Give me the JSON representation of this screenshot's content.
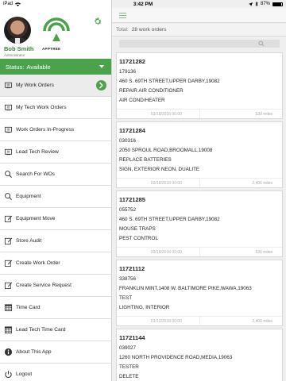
{
  "status_bar": {
    "device": "iPad",
    "time": "3:42 PM",
    "battery_pct": "87%",
    "battery_level": 0.87
  },
  "profile": {
    "name": "Bob Smith",
    "role": "Administrator",
    "logo_text": "APPTREE"
  },
  "status": {
    "label": "Status:",
    "value": "Available"
  },
  "menu": [
    {
      "label": "My Work Orders",
      "icon": "clipboard-icon",
      "active": true
    },
    {
      "label": "My Tech Work Orders",
      "icon": "clipboard-icon"
    },
    {
      "label": "Work Orders In-Progress",
      "icon": "clipboard-icon"
    },
    {
      "label": "Lead Tech Review",
      "icon": "clipboard-icon"
    },
    {
      "label": "Search For WOs",
      "icon": "search-icon"
    },
    {
      "label": "Equipment",
      "icon": "search-icon"
    },
    {
      "label": "Equipment Move",
      "icon": "edit-icon"
    },
    {
      "label": "Store Audit",
      "icon": "edit-icon"
    },
    {
      "label": "Create Work Order",
      "icon": "edit-icon"
    },
    {
      "label": "Create Service Request",
      "icon": "edit-icon"
    },
    {
      "label": "Time Card",
      "icon": "calendar-icon"
    },
    {
      "label": "Lead Tech Time Card",
      "icon": "calendar-icon"
    },
    {
      "label": "About This App",
      "icon": "info-icon"
    },
    {
      "label": "Logout",
      "icon": "power-icon"
    }
  ],
  "main": {
    "total_label": "Total:",
    "total_value": "28 work orders"
  },
  "work_orders": [
    {
      "wo": "11721282",
      "store": "179136",
      "address": "460 S. 69TH STREET,UPPER DARBY,19082",
      "desc": "REPAIR AIR CONDITIONER",
      "category": "AIR COND/HEATER",
      "date": "03/18/2016 00:00",
      "miles": "530 miles"
    },
    {
      "wo": "11721284",
      "store": "030316",
      "address": "2050 SPROUL ROAD,BROOMALL,19008",
      "desc": "REPLACE BATTERIES",
      "category": "SIGN, EXTERIOR NEON, DUALITE",
      "date": "03/18/2016 00:00",
      "miles": "2,400 miles"
    },
    {
      "wo": "11721285",
      "store": "055752",
      "address": "460 S. 69TH STREET,UPPER DARBY,19082",
      "desc": "MOUSE TRAPS",
      "category": "PEST CONTROL",
      "date": "03/18/2016 00:00",
      "miles": "530 miles"
    },
    {
      "wo": "11721112",
      "store": "338756",
      "address": "FRANKLIN MINT,1408 W. BALTIMORE PIKE,WAWA,19063",
      "desc": "TEST",
      "category": "LIGHTING, INTERIOR",
      "date": "01/12/2016 00:00",
      "miles": "2,400 miles"
    },
    {
      "wo": "11721144",
      "store": "039027",
      "address": "1260 NORTH PROVIDENCE ROAD,MEDIA,19063",
      "desc": "TESTER",
      "category": "DELETE",
      "date": "",
      "miles": ""
    }
  ],
  "colors": {
    "accent_green": "#4aa24a",
    "sidebar_bg": "#ffffff",
    "main_bg": "#efefef"
  }
}
